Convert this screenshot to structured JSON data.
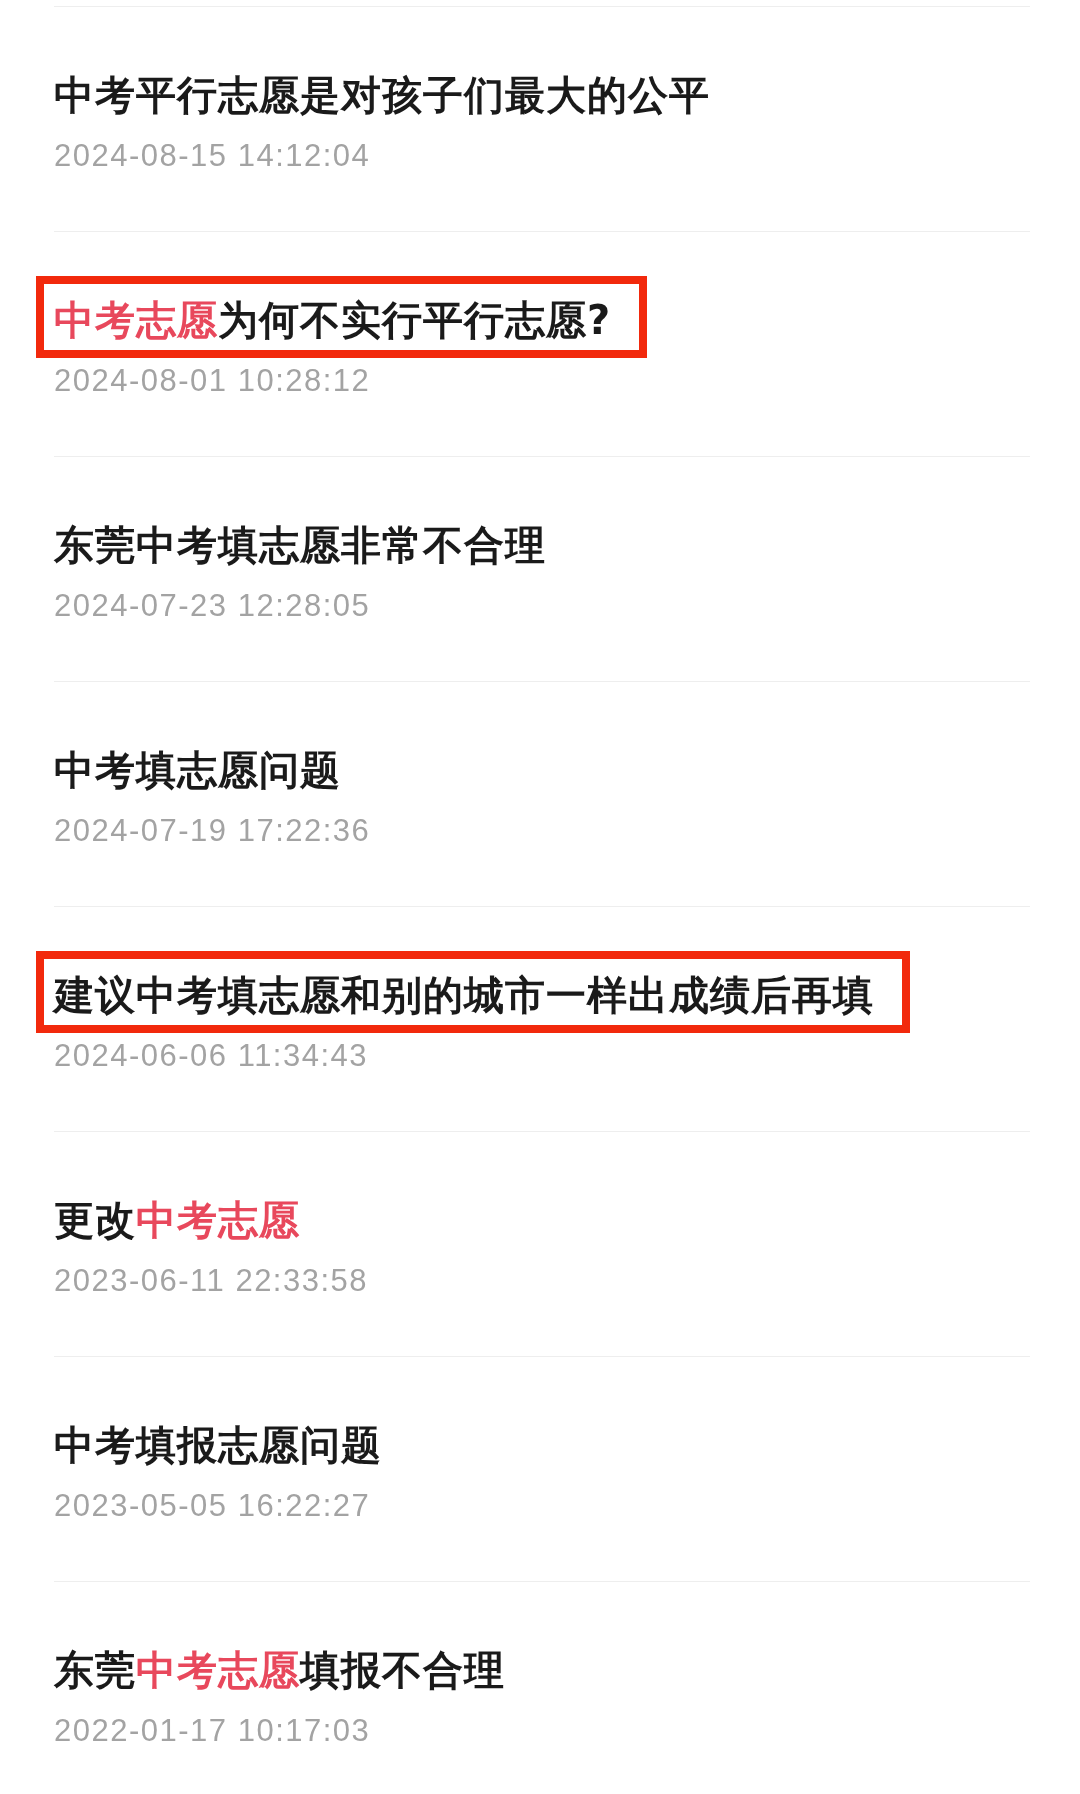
{
  "items": [
    {
      "title": [
        {
          "text": "中考平行志愿是对孩子们最大的公平",
          "highlight": false
        }
      ],
      "date": "2024-08-15 14:12:04",
      "annotated": false
    },
    {
      "title": [
        {
          "text": "中考志愿",
          "highlight": true
        },
        {
          "text": "为何不实行平行志愿?",
          "highlight": false
        }
      ],
      "date": "2024-08-01 10:28:12",
      "annotated": true
    },
    {
      "title": [
        {
          "text": "东莞中考填志愿非常不合理",
          "highlight": false
        }
      ],
      "date": "2024-07-23 12:28:05",
      "annotated": false
    },
    {
      "title": [
        {
          "text": "中考填志愿问题",
          "highlight": false
        }
      ],
      "date": "2024-07-19 17:22:36",
      "annotated": false
    },
    {
      "title": [
        {
          "text": "建议中考填志愿和别的城市一样出成绩后再填",
          "highlight": false
        }
      ],
      "date": "2024-06-06 11:34:43",
      "annotated": true
    },
    {
      "title": [
        {
          "text": "更改",
          "highlight": false
        },
        {
          "text": "中考志愿",
          "highlight": true
        }
      ],
      "date": "2023-06-11 22:33:58",
      "annotated": false
    },
    {
      "title": [
        {
          "text": "中考填报志愿问题",
          "highlight": false
        }
      ],
      "date": "2023-05-05 16:22:27",
      "annotated": false
    },
    {
      "title": [
        {
          "text": "东莞",
          "highlight": false
        },
        {
          "text": "中考志愿",
          "highlight": true
        },
        {
          "text": "填报不合理",
          "highlight": false
        }
      ],
      "date": "2022-01-17 10:17:03",
      "annotated": false
    }
  ]
}
